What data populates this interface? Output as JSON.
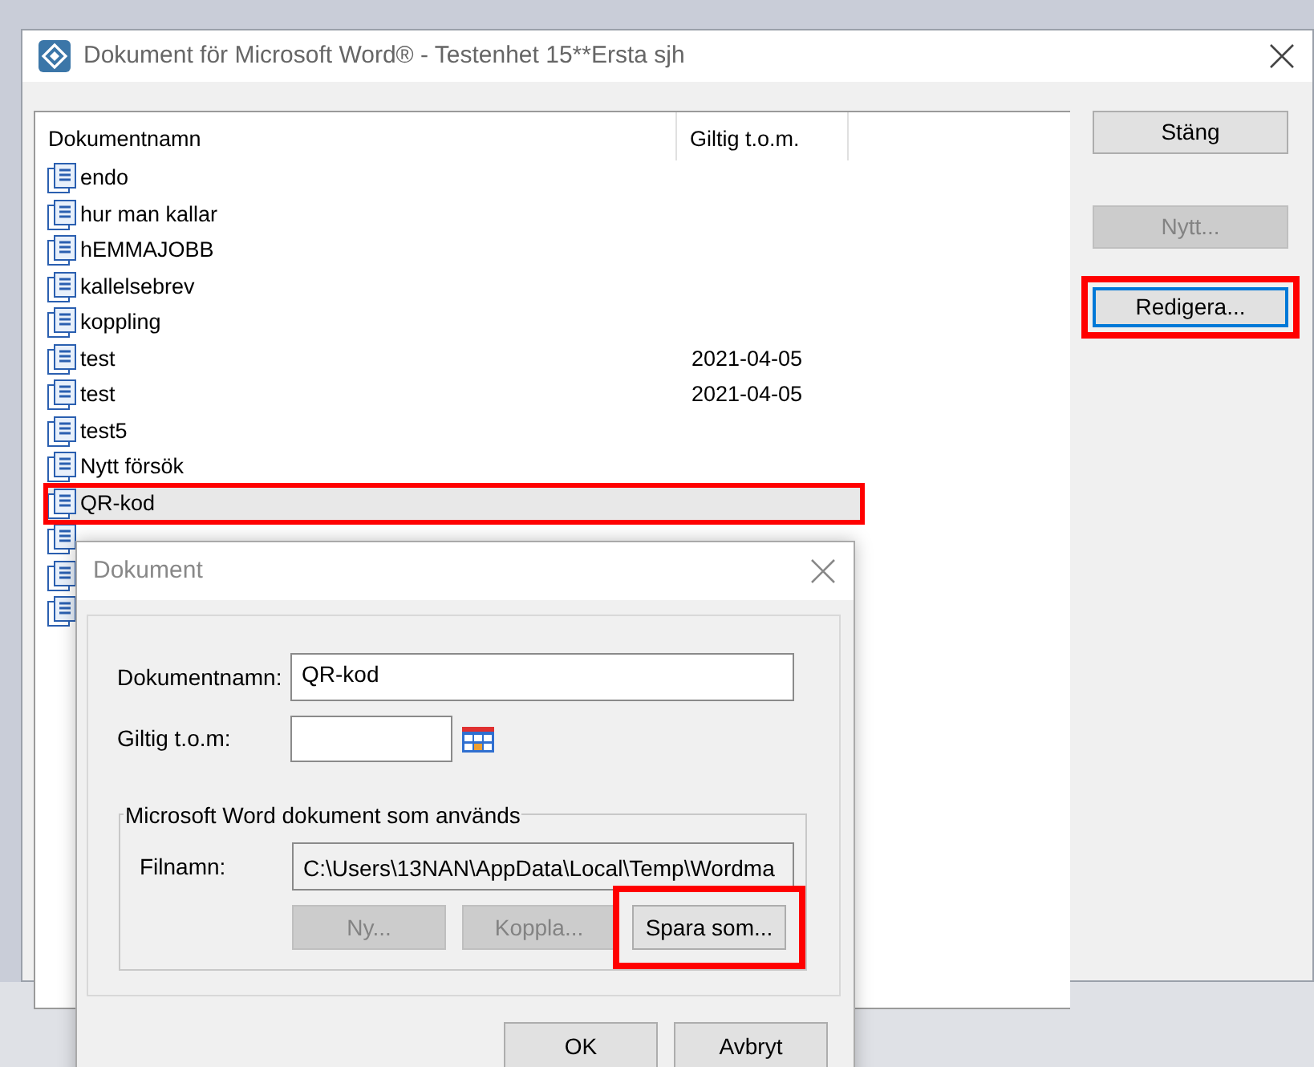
{
  "main_window": {
    "title": "Dokument för Microsoft Word® - Testenhet 15**Ersta sjh"
  },
  "table": {
    "columns": [
      "Dokumentnamn",
      "Giltig t.o.m."
    ],
    "rows": [
      {
        "kind": "doc",
        "name": "endo",
        "valid_until": null,
        "selected": false,
        "highlighted": false
      },
      {
        "kind": "doc",
        "name": "hur man kallar",
        "valid_until": null,
        "selected": false,
        "highlighted": false
      },
      {
        "kind": "doc",
        "name": "hEMMAJOBB",
        "valid_until": null,
        "selected": false,
        "highlighted": false
      },
      {
        "kind": "doc",
        "name": "kallelsebrev",
        "valid_until": null,
        "selected": false,
        "highlighted": false
      },
      {
        "kind": "doc",
        "name": "koppling",
        "valid_until": null,
        "selected": false,
        "highlighted": false
      },
      {
        "kind": "doc",
        "name": "test",
        "valid_until": "2021-04-05",
        "selected": false,
        "highlighted": false
      },
      {
        "kind": "doc",
        "name": "test",
        "valid_until": "2021-04-05",
        "selected": false,
        "highlighted": false
      },
      {
        "kind": "doc",
        "name": "test5",
        "valid_until": null,
        "selected": false,
        "highlighted": false
      },
      {
        "kind": "doc",
        "name": "Nytt försök",
        "valid_until": null,
        "selected": false,
        "highlighted": false
      },
      {
        "kind": "doc",
        "name": "QR-kod",
        "valid_until": null,
        "selected": true,
        "highlighted": true
      },
      {
        "kind": "covered",
        "selected": false,
        "highlighted": false
      },
      {
        "kind": "covered",
        "selected": false,
        "highlighted": false
      },
      {
        "kind": "covered",
        "selected": false,
        "highlighted": false
      }
    ]
  },
  "side_buttons": [
    {
      "label": "Stäng",
      "disabled": false,
      "focused": false,
      "highlighted": false
    },
    {
      "label": "Nytt...",
      "disabled": true,
      "focused": false,
      "highlighted": false
    },
    {
      "label": "Redigera...",
      "disabled": false,
      "focused": true,
      "highlighted": true
    }
  ],
  "dialog": {
    "title": "Dokument",
    "name_label": "Dokumentnamn:",
    "name_value": "QR-kod",
    "valid_label": "Giltig t.o.m:",
    "group_title": "Microsoft Word dokument som används",
    "file_label": "Filnamn:",
    "file_value": "C:\\Users\\13NAN\\AppData\\Local\\Temp\\Wordma",
    "group_buttons": [
      {
        "label": "Ny...",
        "disabled": true,
        "highlighted": false
      },
      {
        "label": "Koppla...",
        "disabled": true,
        "highlighted": false
      },
      {
        "label": "Spara som...",
        "disabled": false,
        "highlighted": true
      }
    ],
    "buttons": [
      {
        "label": "OK"
      },
      {
        "label": "Avbryt"
      }
    ]
  }
}
